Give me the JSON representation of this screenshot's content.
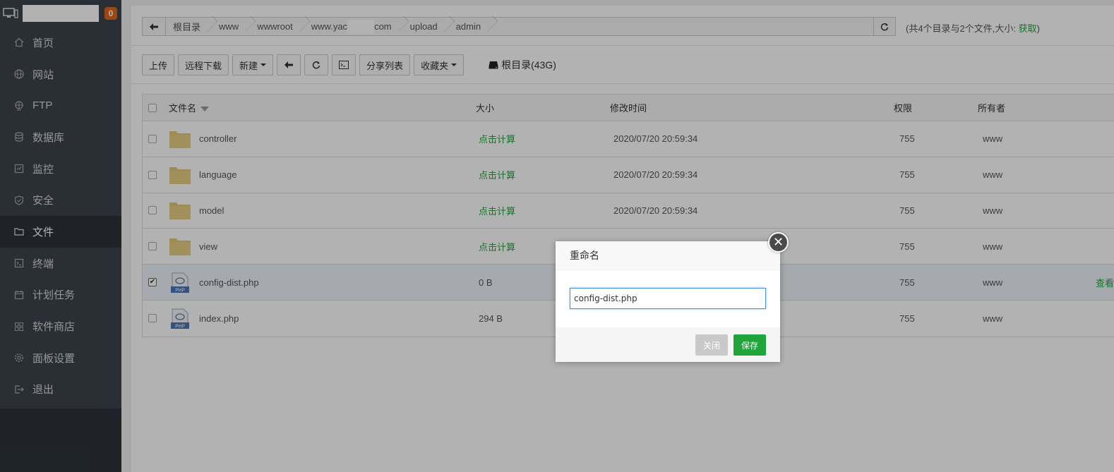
{
  "sidebar": {
    "badge": "0",
    "items": [
      {
        "label": "首页",
        "icon": "home-icon"
      },
      {
        "label": "网站",
        "icon": "globe-icon"
      },
      {
        "label": "FTP",
        "icon": "ftp-icon"
      },
      {
        "label": "数据库",
        "icon": "database-icon"
      },
      {
        "label": "监控",
        "icon": "monitor-icon"
      },
      {
        "label": "安全",
        "icon": "shield-icon"
      },
      {
        "label": "文件",
        "icon": "folder-icon",
        "active": true
      },
      {
        "label": "终端",
        "icon": "terminal-icon"
      },
      {
        "label": "计划任务",
        "icon": "calendar-icon"
      },
      {
        "label": "软件商店",
        "icon": "grid-icon"
      },
      {
        "label": "面板设置",
        "icon": "gear-icon"
      },
      {
        "label": "退出",
        "icon": "logout-icon"
      }
    ]
  },
  "path": {
    "crumbs": [
      "根目录",
      "www",
      "wwwroot",
      "www.yac",
      "upload",
      "admin"
    ],
    "domain_suffix": "com",
    "summary_prefix": "(共4个目录与2个文件,大小: ",
    "summary_link": "获取",
    "summary_suffix": ")"
  },
  "toolbar": {
    "upload": "上传",
    "remote_download": "远程下载",
    "new": "新建",
    "share_list": "分享列表",
    "favorites": "收藏夹",
    "disk": "根目录(43G)"
  },
  "table": {
    "headers": {
      "name": "文件名",
      "size": "大小",
      "mtime": "修改时间",
      "perm": "权限",
      "owner": "所有者"
    },
    "rows": [
      {
        "name": "controller",
        "type": "folder",
        "size": "点击计算",
        "mtime": "2020/07/20 20:59:34",
        "perm": "755",
        "owner": "www"
      },
      {
        "name": "language",
        "type": "folder",
        "size": "点击计算",
        "mtime": "2020/07/20 20:59:34",
        "perm": "755",
        "owner": "www"
      },
      {
        "name": "model",
        "type": "folder",
        "size": "点击计算",
        "mtime": "2020/07/20 20:59:34",
        "perm": "755",
        "owner": "www"
      },
      {
        "name": "view",
        "type": "folder",
        "size": "点击计算",
        "mtime": "",
        "perm": "755",
        "owner": "www"
      },
      {
        "name": "config-dist.php",
        "type": "php",
        "size": "0 B",
        "mtime": "",
        "perm": "755",
        "owner": "www",
        "checked": true,
        "op": "查看"
      },
      {
        "name": "index.php",
        "type": "php",
        "size": "294 B",
        "mtime": "",
        "perm": "755",
        "owner": "www"
      }
    ]
  },
  "modal": {
    "title": "重命名",
    "input_value": "config-dist.php",
    "close_label": "关闭",
    "save_label": "保存"
  },
  "colors": {
    "accent": "#20a53a",
    "sidebar": "#3c444d",
    "badge": "#e0651b"
  }
}
